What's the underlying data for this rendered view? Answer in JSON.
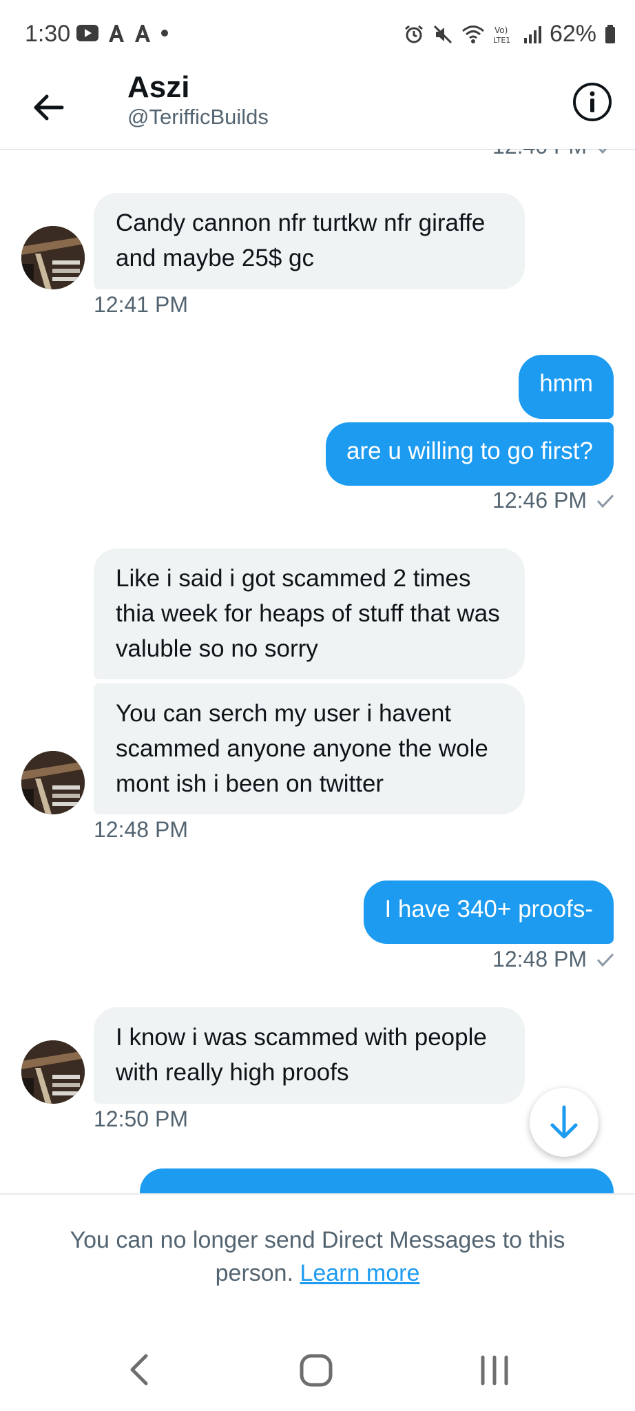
{
  "status_bar": {
    "time": "1:30",
    "battery": "62%"
  },
  "header": {
    "name": "Aszi",
    "handle": "@TerifficBuilds"
  },
  "messages": {
    "top_partial_time": "12:40 PM",
    "m1_text": "Candy cannon nfr turtkw nfr giraffe and maybe 25$ gc",
    "m1_time": "12:41 PM",
    "m2_text": "hmm",
    "m3_text": "are u willing to go first?",
    "m3_time": "12:46 PM",
    "m4_text": "Like i said i got scammed 2 times thia week for heaps of stuff that was valuble so no sorry",
    "m5_text": "You  can serch  my user i havent scammed anyone anyone the wole mont ish i been on twitter",
    "m5_time": "12:48 PM",
    "m6_text": "I have 340+ proofs-",
    "m6_time": "12:48 PM",
    "m7_text": "I know i was scammed with people with really high proofs",
    "m7_time": "12:50 PM"
  },
  "footer": {
    "notice": "You can no longer send Direct Messages to this person.",
    "learn_more": "Learn more"
  },
  "colors": {
    "accent": "#1d9bf0",
    "incoming_bubble": "#eff3f4",
    "secondary_text": "#536471"
  }
}
